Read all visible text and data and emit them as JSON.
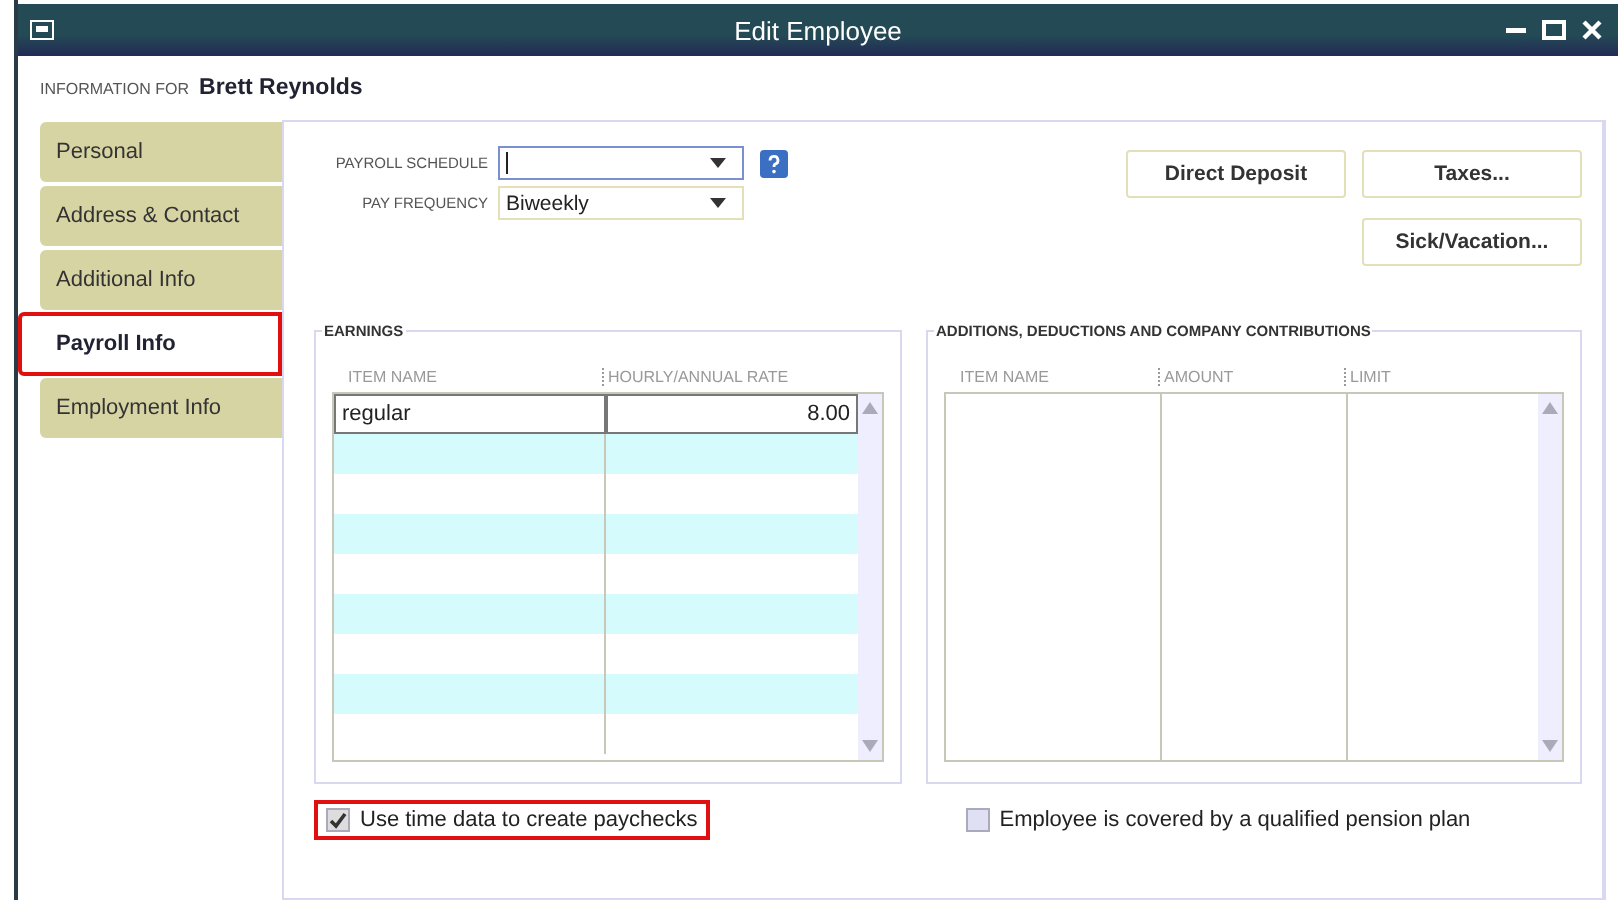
{
  "window": {
    "title": "Edit Employee"
  },
  "information_for": {
    "label": "INFORMATION FOR",
    "name": "Brett Reynolds"
  },
  "tabs": [
    {
      "label": "Personal",
      "selected": false,
      "highlighted": false
    },
    {
      "label": "Address & Contact",
      "selected": false,
      "highlighted": false
    },
    {
      "label": "Additional Info",
      "selected": false,
      "highlighted": false
    },
    {
      "label": "Payroll Info",
      "selected": true,
      "highlighted": true
    },
    {
      "label": "Employment Info",
      "selected": false,
      "highlighted": false
    }
  ],
  "payroll_schedule": {
    "label": "PAYROLL SCHEDULE",
    "focused": true
  },
  "pay_frequency": {
    "label": "PAY FREQUENCY",
    "value": "Biweekly"
  },
  "buttons": [
    "Direct Deposit",
    "Taxes...",
    "Sick/Vacation..."
  ],
  "earnings": {
    "title": "EARNINGS",
    "columns": [
      "ITEM NAME",
      "HOURLY/ANNUAL RATE"
    ],
    "rows": [
      [
        "regular",
        "8.00"
      ]
    ]
  },
  "additions": {
    "title": "ADDITIONS, DEDUCTIONS AND COMPANY CONTRIBUTIONS",
    "columns": [
      "ITEM NAME",
      "AMOUNT",
      "LIMIT"
    ]
  },
  "options": [
    {
      "label": "Use time data to create paychecks",
      "checked": true,
      "highlighted": true
    },
    {
      "label": "Employee is covered by a qualified pension plan",
      "checked": false,
      "highlighted": false
    }
  ]
}
